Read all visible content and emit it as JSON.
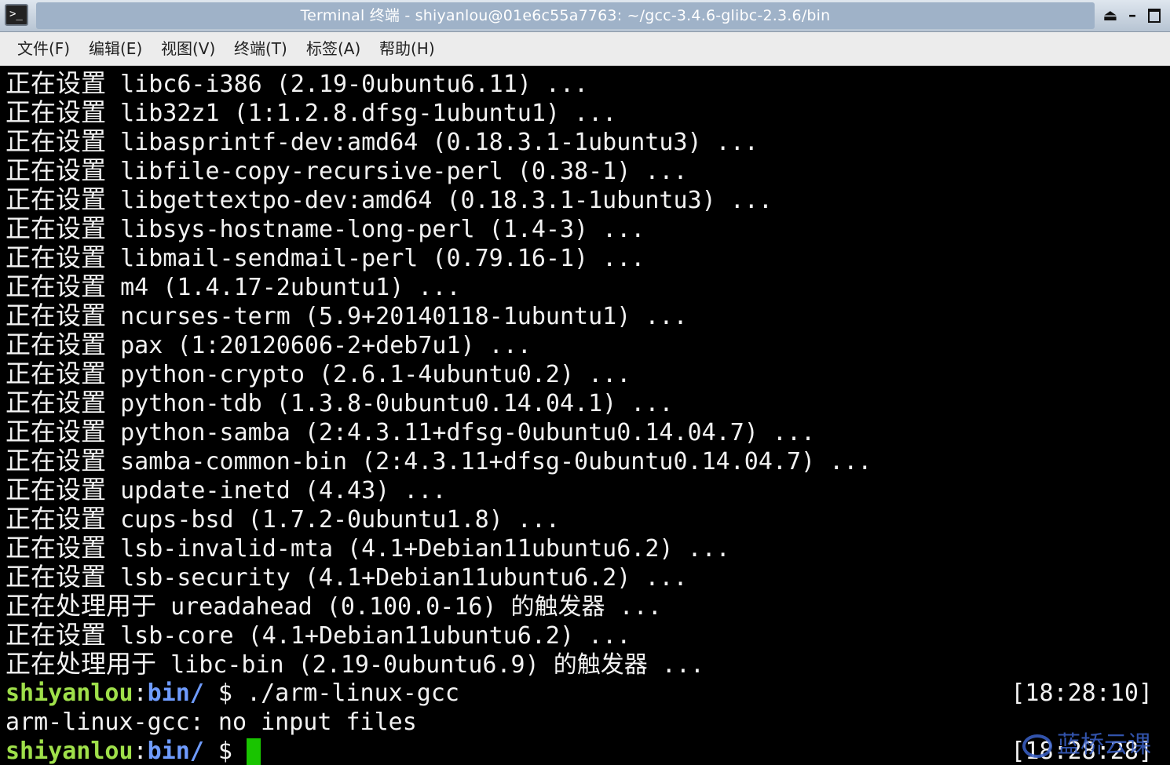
{
  "window": {
    "title": "Terminal 终端 - shiyanlou@01e6c55a7763: ~/gcc-3.4.6-glibc-2.3.6/bin"
  },
  "menu": {
    "items": [
      "文件(F)",
      "编辑(E)",
      "视图(V)",
      "终端(T)",
      "标签(A)",
      "帮助(H)"
    ]
  },
  "terminal": {
    "output_lines": [
      {
        "prefix": "正在设置",
        "text": " libc6-i386 (2.19-0ubuntu6.11) ..."
      },
      {
        "prefix": "正在设置",
        "text": " lib32z1 (1:1.2.8.dfsg-1ubuntu1) ..."
      },
      {
        "prefix": "正在设置",
        "text": " libasprintf-dev:amd64 (0.18.3.1-1ubuntu3) ..."
      },
      {
        "prefix": "正在设置",
        "text": " libfile-copy-recursive-perl (0.38-1) ..."
      },
      {
        "prefix": "正在设置",
        "text": " libgettextpo-dev:amd64 (0.18.3.1-1ubuntu3) ..."
      },
      {
        "prefix": "正在设置",
        "text": " libsys-hostname-long-perl (1.4-3) ..."
      },
      {
        "prefix": "正在设置",
        "text": " libmail-sendmail-perl (0.79.16-1) ..."
      },
      {
        "prefix": "正在设置",
        "text": " m4 (1.4.17-2ubuntu1) ..."
      },
      {
        "prefix": "正在设置",
        "text": " ncurses-term (5.9+20140118-1ubuntu1) ..."
      },
      {
        "prefix": "正在设置",
        "text": " pax (1:20120606-2+deb7u1) ..."
      },
      {
        "prefix": "正在设置",
        "text": " python-crypto (2.6.1-4ubuntu0.2) ..."
      },
      {
        "prefix": "正在设置",
        "text": " python-tdb (1.3.8-0ubuntu0.14.04.1) ..."
      },
      {
        "prefix": "正在设置",
        "text": " python-samba (2:4.3.11+dfsg-0ubuntu0.14.04.7) ..."
      },
      {
        "prefix": "正在设置",
        "text": " samba-common-bin (2:4.3.11+dfsg-0ubuntu0.14.04.7) ..."
      },
      {
        "prefix": "正在设置",
        "text": " update-inetd (4.43) ..."
      },
      {
        "prefix": "正在设置",
        "text": " cups-bsd (1.7.2-0ubuntu1.8) ..."
      },
      {
        "prefix": "正在设置",
        "text": " lsb-invalid-mta (4.1+Debian11ubuntu6.2) ..."
      },
      {
        "prefix": "正在设置",
        "text": " lsb-security (4.1+Debian11ubuntu6.2) ..."
      },
      {
        "prefix": "正在处理用于",
        "text": " ureadahead (0.100.0-16) 的触发器 ..."
      },
      {
        "prefix": "正在设置",
        "text": " lsb-core (4.1+Debian11ubuntu6.2) ..."
      },
      {
        "prefix": "正在处理用于",
        "text": " libc-bin (2.19-0ubuntu6.9) 的触发器 ..."
      }
    ],
    "prompt1": {
      "user": "shiyanlou",
      "sep": ":",
      "dir": "bin/",
      "symbol": " $ ",
      "command": "./arm-linux-gcc",
      "time": "[18:28:10]"
    },
    "error_line": "arm-linux-gcc: no input files",
    "prompt2": {
      "user": "shiyanlou",
      "sep": ":",
      "dir": "bin/",
      "symbol": " $ ",
      "time": "[18:28:28]"
    },
    "cursor_color": "#19c400",
    "user_color": "#9fe04a",
    "dir_color": "#6f9cff"
  },
  "watermark": {
    "text": "蓝桥云课"
  }
}
